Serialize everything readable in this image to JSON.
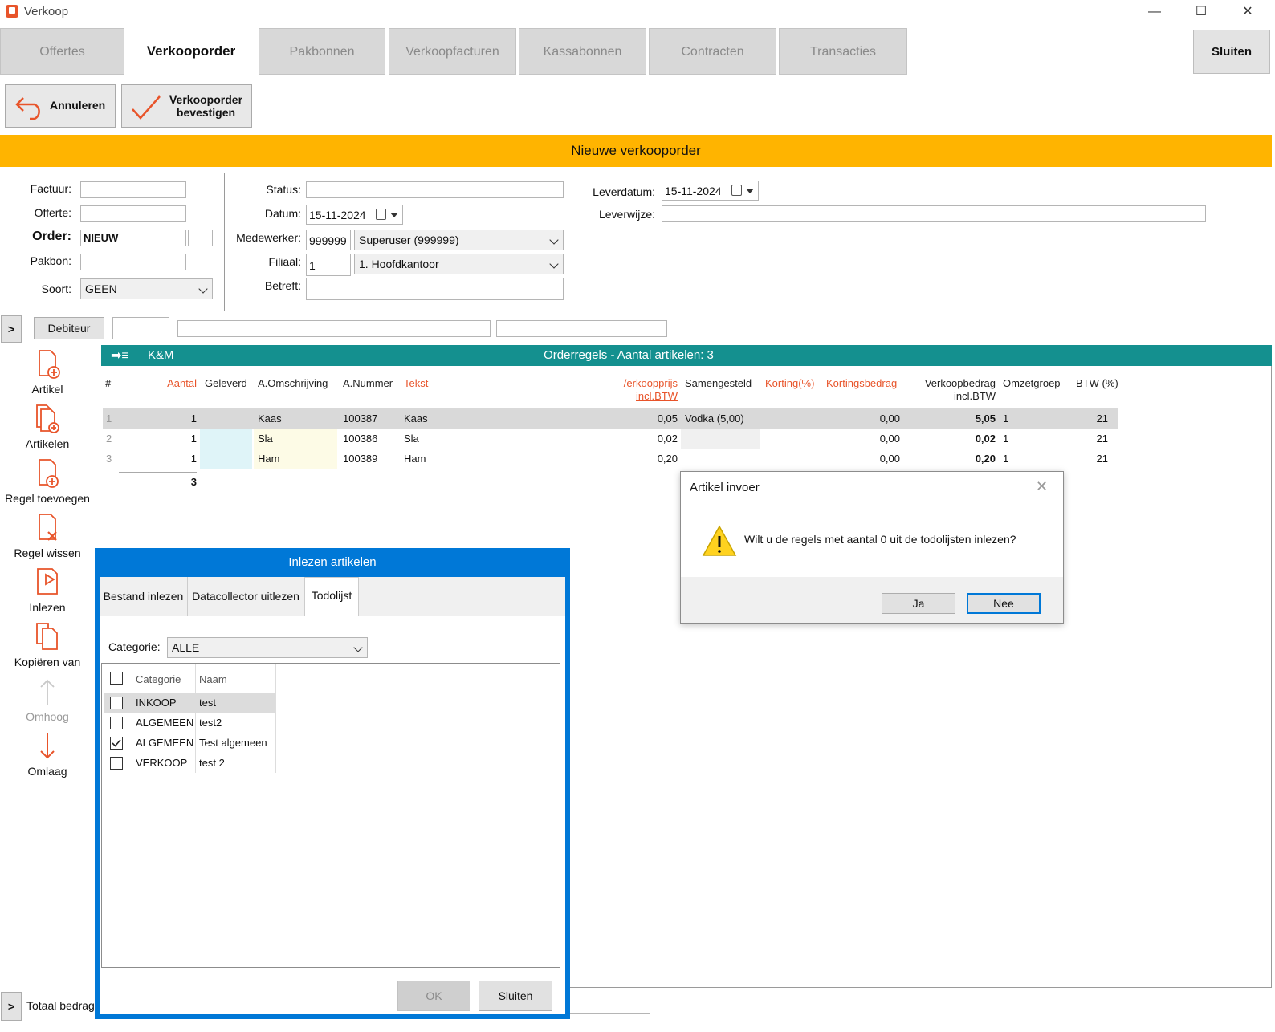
{
  "window": {
    "title": "Verkoop"
  },
  "tabs": [
    {
      "label": "Offertes"
    },
    {
      "label": "Verkooporder"
    },
    {
      "label": "Pakbonnen"
    },
    {
      "label": "Verkoopfacturen"
    },
    {
      "label": "Kassabonnen"
    },
    {
      "label": "Contracten"
    },
    {
      "label": "Transacties"
    }
  ],
  "close_button": "Sluiten",
  "toolbar": {
    "cancel": "Annuleren",
    "confirm_line1": "Verkooporder",
    "confirm_line2": "bevestigen"
  },
  "banner": "Nieuwe verkooporder",
  "form": {
    "factuur_label": "Factuur:",
    "offerte_label": "Offerte:",
    "order_label": "Order:",
    "order_value": "NIEUW",
    "pakbon_label": "Pakbon:",
    "soort_label": "Soort:",
    "soort_value": "GEEN",
    "status_label": "Status:",
    "datum_label": "Datum:",
    "datum_value": "15-11-2024",
    "medewerker_label": "Medewerker:",
    "medewerker_code": "999999",
    "medewerker_name": "Superuser (999999)",
    "filiaal_label": "Filiaal:",
    "filiaal_code": "1",
    "filiaal_name": "1. Hoofdkantoor",
    "betreft_label": "Betreft:",
    "leverdatum_label": "Leverdatum:",
    "leverdatum_value": "15-11-2024",
    "leverwijze_label": "Leverwijze:"
  },
  "debiteur": {
    "expand": ">",
    "button": "Debiteur"
  },
  "grid": {
    "title_left": "K&M",
    "title": "Orderregels - Aantal artikelen: 3",
    "columns": {
      "nr": "#",
      "aantal": "Aantal",
      "geleverd": "Geleverd",
      "omschrijving": "A.Omschrijving",
      "nummer": "A.Nummer",
      "tekst": "Tekst",
      "prijs_l1": "/erkoopprijs",
      "prijs_l2": "incl.BTW",
      "samengesteld": "Samengesteld",
      "korting": "Korting(%)",
      "kortingsbedrag": "Kortingsbedrag",
      "bedrag_l1": "Verkoopbedrag",
      "bedrag_l2": "incl.BTW",
      "omzetgroep": "Omzetgroep",
      "btw": "BTW (%)"
    },
    "rows": [
      {
        "nr": "1",
        "aantal": "1",
        "omschrijving": "Kaas",
        "nummer": "100387",
        "tekst": "Kaas",
        "prijs": "0,05",
        "samengesteld": "Vodka (5,00)",
        "kortingsbedrag": "0,00",
        "bedrag": "5,05",
        "omzetgroep": "1",
        "btw": "21"
      },
      {
        "nr": "2",
        "aantal": "1",
        "omschrijving": "Sla",
        "nummer": "100386",
        "tekst": "Sla",
        "prijs": "0,02",
        "samengesteld": "",
        "kortingsbedrag": "0,00",
        "bedrag": "0,02",
        "omzetgroep": "1",
        "btw": "21"
      },
      {
        "nr": "3",
        "aantal": "1",
        "omschrijving": "Ham",
        "nummer": "100389",
        "tekst": "Ham",
        "prijs": "0,20",
        "samengesteld": "",
        "kortingsbedrag": "0,00",
        "bedrag": "0,20",
        "omzetgroep": "1",
        "btw": "21"
      }
    ],
    "total_aantal": "3"
  },
  "sidebar": [
    {
      "label": "Artikel"
    },
    {
      "label": "Artikelen"
    },
    {
      "label": "Regel toevoegen"
    },
    {
      "label": "Regel wissen"
    },
    {
      "label": "Inlezen"
    },
    {
      "label": "Kopiëren van"
    },
    {
      "label": "Omhoog"
    },
    {
      "label": "Omlaag"
    }
  ],
  "bottom": {
    "expand": ">",
    "totaal_label": "Totaal bedrag"
  },
  "inlezen_dialog": {
    "title": "Inlezen artikelen",
    "tabs": [
      {
        "label": "Bestand inlezen"
      },
      {
        "label": "Datacollector uitlezen"
      },
      {
        "label": "Todolijst"
      }
    ],
    "categorie_label": "Categorie:",
    "categorie_value": "ALLE",
    "col_categorie": "Categorie",
    "col_naam": "Naam",
    "rows": [
      {
        "categorie": "INKOOP",
        "naam": "test",
        "checked": false
      },
      {
        "categorie": "ALGEMEEN",
        "naam": "test2",
        "checked": false
      },
      {
        "categorie": "ALGEMEEN",
        "naam": "Test algemeen",
        "checked": true
      },
      {
        "categorie": "VERKOOP",
        "naam": "test 2",
        "checked": false
      }
    ],
    "ok": "OK",
    "sluiten": "Sluiten"
  },
  "message_box": {
    "title": "Artikel invoer",
    "message": "Wilt u de regels met aantal 0 uit de todolijsten inlezen?",
    "yes": "Ja",
    "no": "Nee"
  },
  "colors": {
    "accent": "#e8542a",
    "banner": "#ffb400",
    "grid_header": "#14908f",
    "dialog_frame": "#0078d7"
  }
}
